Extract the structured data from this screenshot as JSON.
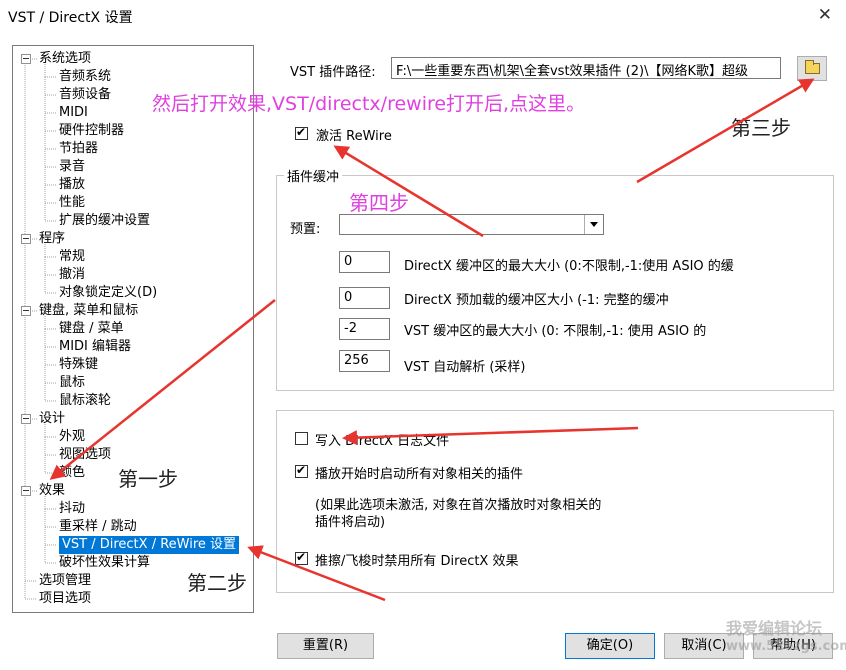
{
  "window": {
    "title": "VST / DirectX 设置",
    "close_glyph": "✕"
  },
  "tree": {
    "items": [
      {
        "label": "系统选项",
        "level": 0
      },
      {
        "label": "音频系统",
        "level": 1
      },
      {
        "label": "音频设备",
        "level": 1
      },
      {
        "label": "MIDI",
        "level": 1
      },
      {
        "label": "硬件控制器",
        "level": 1
      },
      {
        "label": "节拍器",
        "level": 1
      },
      {
        "label": "录音",
        "level": 1
      },
      {
        "label": "播放",
        "level": 1
      },
      {
        "label": "性能",
        "level": 1
      },
      {
        "label": "扩展的缓冲设置",
        "level": 1
      },
      {
        "label": "程序",
        "level": 0
      },
      {
        "label": "常规",
        "level": 1
      },
      {
        "label": "撤消",
        "level": 1
      },
      {
        "label": "对象锁定定义(D)",
        "level": 1
      },
      {
        "label": "键盘, 菜单和鼠标",
        "level": 0
      },
      {
        "label": "键盘 / 菜单",
        "level": 1
      },
      {
        "label": "MIDI 编辑器",
        "level": 1
      },
      {
        "label": "特殊键",
        "level": 1
      },
      {
        "label": "鼠标",
        "level": 1
      },
      {
        "label": "鼠标滚轮",
        "level": 1
      },
      {
        "label": "设计",
        "level": 0
      },
      {
        "label": "外观",
        "level": 1
      },
      {
        "label": "视图选项",
        "level": 1
      },
      {
        "label": "颜色",
        "level": 1
      },
      {
        "label": "效果",
        "level": 0
      },
      {
        "label": "抖动",
        "level": 1
      },
      {
        "label": "重采样 / 跳动",
        "level": 1
      },
      {
        "label": "VST / DirectX / ReWire 设置",
        "level": 1,
        "selected": true
      },
      {
        "label": "破坏性效果计算",
        "level": 1
      },
      {
        "label": "选项管理",
        "level": 0,
        "leaf": true
      },
      {
        "label": "项目选项",
        "level": 0,
        "leaf": true
      }
    ]
  },
  "vst": {
    "path_label": "VST 插件路径:",
    "path_value": "F:\\一些重要东西\\机架\\全套vst效果插件 (2)\\【网络K歌】超级",
    "rewire_label": "激活 ReWire",
    "rewire_checked": true
  },
  "buffer_group": {
    "caption": "插件缓冲",
    "preset_label": "预置:",
    "preset_value": "",
    "fields": [
      {
        "value": "0",
        "label": "DirectX 缓冲区的最大大小 (0:不限制,-1:使用 ASIO 的缓"
      },
      {
        "value": "0",
        "label": "DirectX 预加载的缓冲区大小 (-1: 完整的缓冲"
      },
      {
        "value": "-2",
        "label": "VST 缓冲区的最大大小 (0: 不限制,-1: 使用 ASIO 的"
      },
      {
        "value": "256",
        "label": "VST 自动解析 (采样)"
      }
    ]
  },
  "options_group": {
    "log_label": "写入 DirectX 日志文件",
    "log_checked": false,
    "start_plugins_label": "播放开始时启动所有对象相关的插件",
    "start_plugins_checked": true,
    "note_line1": "(如果此选项未激活, 对象在首次播放时对象相关的",
    "note_line2": "插件将启动)",
    "scrub_label": "推擦/飞梭时禁用所有 DirectX 效果",
    "scrub_checked": true
  },
  "buttons": {
    "reset": "重置(R)",
    "ok": "确定(O)",
    "cancel": "取消(C)",
    "help": "帮助(H)"
  },
  "annotations": {
    "instruction": "然后打开效果,VST/directx/rewire打开后,点这里。",
    "step1": "第一步",
    "step2": "第二步",
    "step3": "第三步",
    "step4": "第四步",
    "arrow_color": "#e8342e",
    "text_color": "#e040e0"
  },
  "watermark": {
    "line1": "我爱编辑论坛",
    "line2": "www.52ezgs.com"
  }
}
